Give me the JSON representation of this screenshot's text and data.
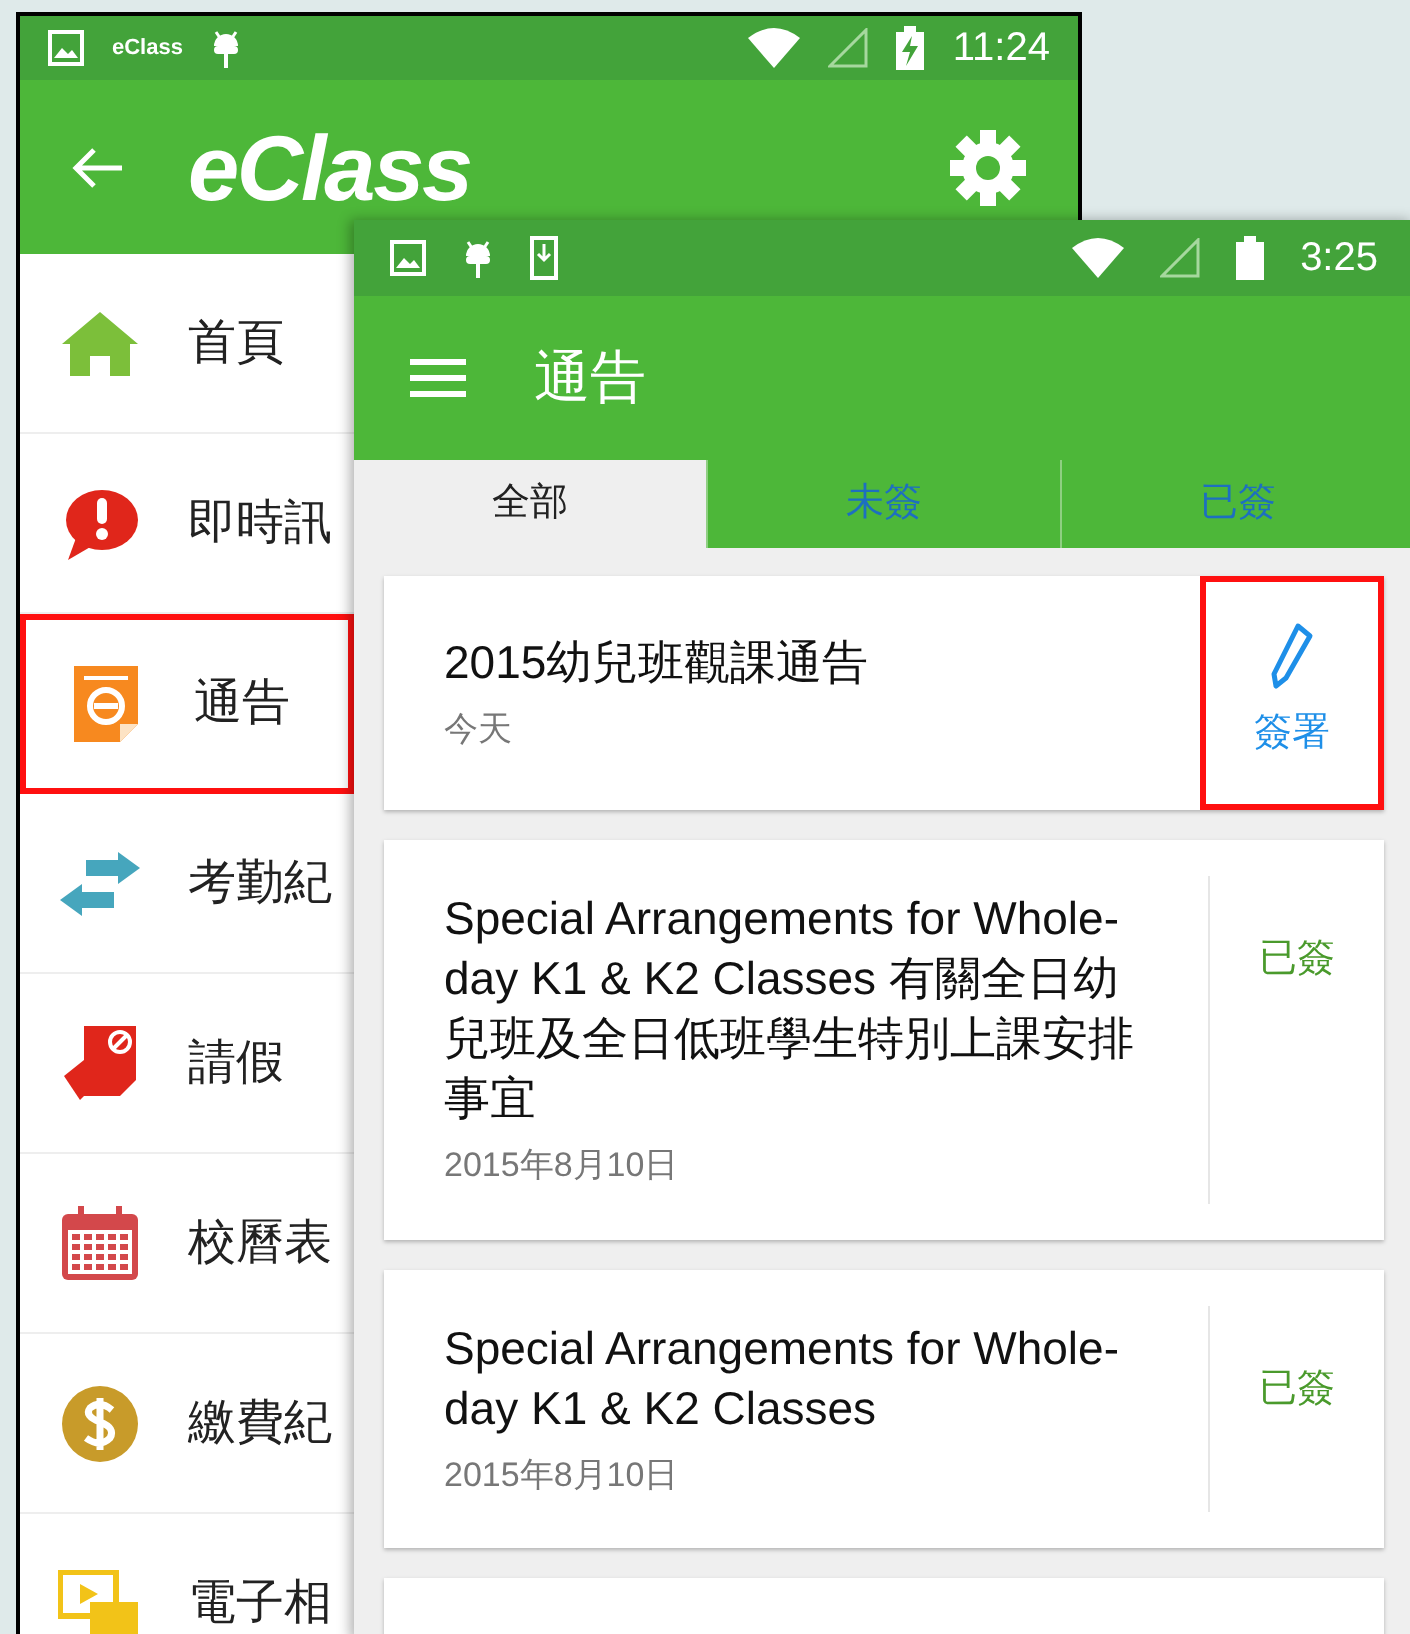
{
  "back_phone": {
    "status_bar": {
      "app_label": "eClass",
      "time": "11:24"
    },
    "app_bar": {
      "title": "eClass"
    },
    "menu": [
      {
        "label": "首頁",
        "selected": false
      },
      {
        "label": "即時訊",
        "selected": false
      },
      {
        "label": "通告",
        "selected": true
      },
      {
        "label": "考勤紀",
        "selected": false
      },
      {
        "label": "請假",
        "selected": false
      },
      {
        "label": "校曆表",
        "selected": false
      },
      {
        "label": "繳費紀",
        "selected": false
      },
      {
        "label": "電子相",
        "selected": false
      }
    ]
  },
  "front_phone": {
    "status_bar": {
      "time": "3:25"
    },
    "app_bar": {
      "title": "通告"
    },
    "tabs": [
      {
        "label": "全部",
        "selected": true
      },
      {
        "label": "未簽",
        "selected": false
      },
      {
        "label": "已簽",
        "selected": false
      }
    ],
    "notices": [
      {
        "title": "2015幼兒班觀課通告",
        "date": "今天",
        "kind": "sign",
        "action": "簽署",
        "highlighted": true
      },
      {
        "title": "Special Arrangements for Whole-day K1 & K2 Classes 有關全日幼兒班及全日低班學生特別上課安排事宜",
        "date": "2015年8月10日",
        "kind": "signed",
        "action": "已簽"
      },
      {
        "title": "Special Arrangements for Whole-day K1 & K2 Classes",
        "date": "2015年8月10日",
        "kind": "signed",
        "action": "已簽"
      }
    ]
  }
}
